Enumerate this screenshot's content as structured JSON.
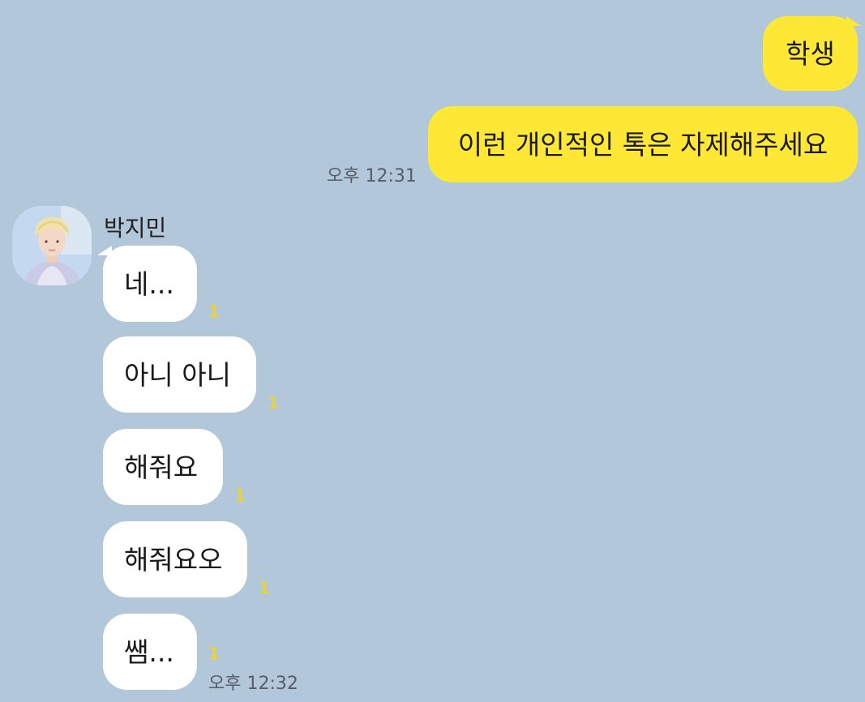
{
  "sent_messages": [
    {
      "text": "학생"
    },
    {
      "text": "이런 개인적인 톡은 자제해주세요",
      "time": "오후 12:31"
    }
  ],
  "sender": {
    "name": "박지민",
    "avatar_icon": "avatar-photo-icon"
  },
  "received_messages": [
    {
      "text": "네...",
      "unread": "1"
    },
    {
      "text": "아니 아니",
      "unread": "1"
    },
    {
      "text": "해줘요",
      "unread": "1"
    },
    {
      "text": "해줘요오",
      "unread": "1"
    },
    {
      "text": "쌤...",
      "unread": "1",
      "time": "오후 12:32"
    }
  ],
  "colors": {
    "background": "#b2c7da",
    "sent_bubble": "#fee835",
    "received_bubble": "#ffffff",
    "unread_count": "#e6d43a"
  }
}
